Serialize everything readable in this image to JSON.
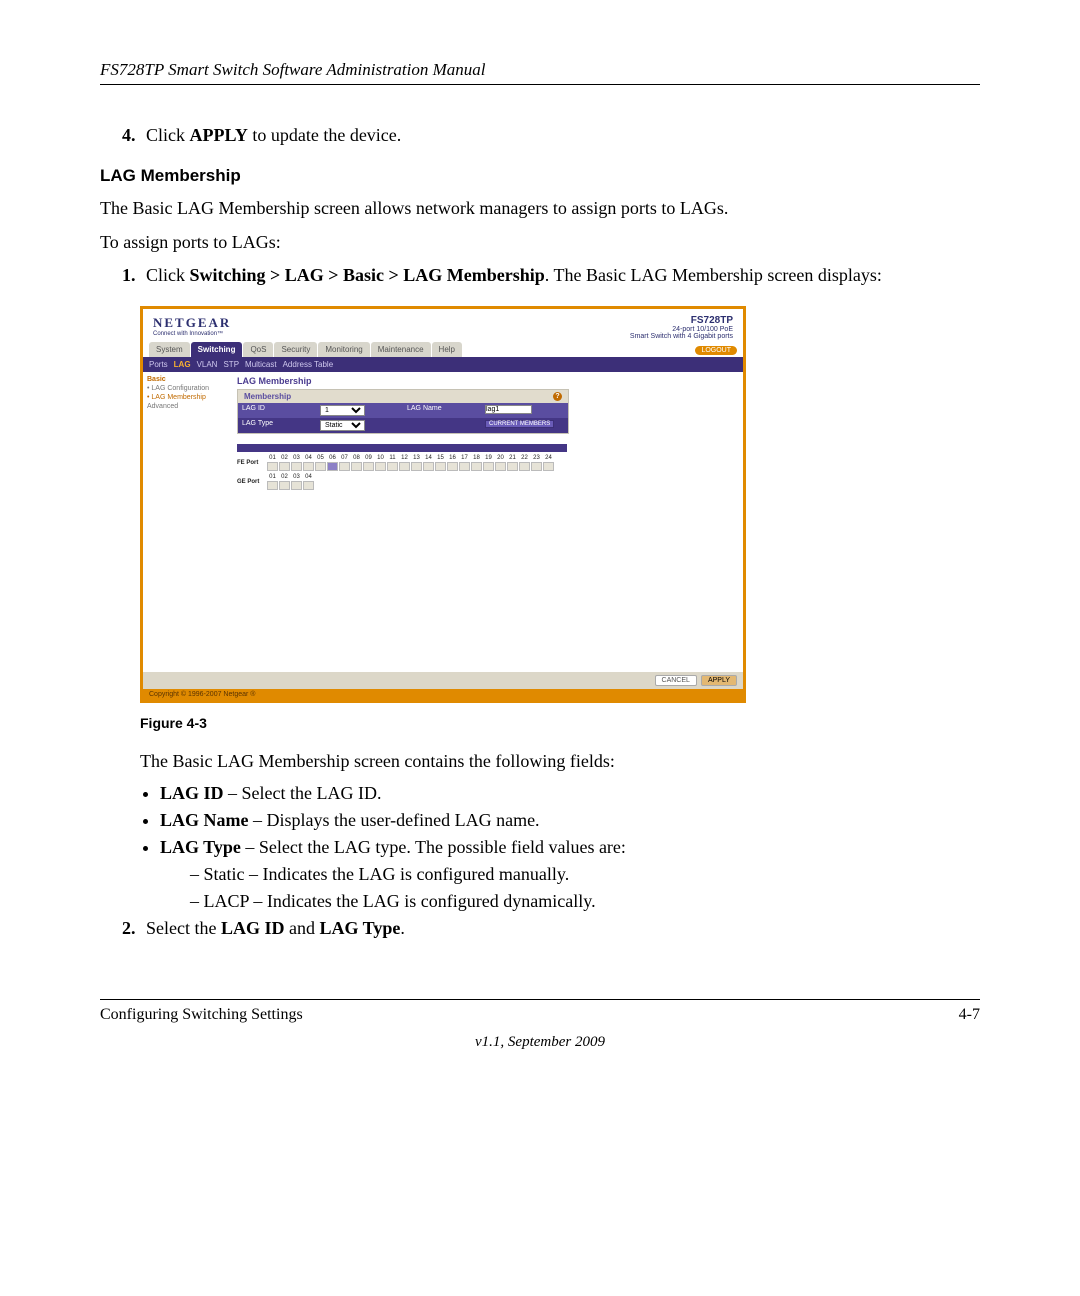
{
  "headerTitle": "FS728TP Smart Switch Software Administration Manual",
  "step4_pre": "Click ",
  "step4_bold": "APPLY",
  "step4_post": " to update the device.",
  "sectionHeading": "LAG Membership",
  "intro1": "The Basic LAG Membership screen allows network managers to assign ports to LAGs.",
  "intro2": "To assign ports to LAGs:",
  "step1_pre": "Click ",
  "step1_bold": "Switching > LAG > Basic > LAG Membership",
  "step1_post": ". The Basic LAG Membership screen displays:",
  "figureCaption": "Figure 4-3",
  "afterFigure": "The Basic LAG Membership screen contains the following fields:",
  "bullet1_bold": "LAG ID",
  "bullet1_rest": " – Select the LAG ID.",
  "bullet2_bold": "LAG Name",
  "bullet2_rest": " – Displays the user-defined LAG name.",
  "bullet3_bold": "LAG Type",
  "bullet3_rest": " – Select the LAG type. The possible field values are:",
  "dash1": "Static – Indicates the LAG is configured manually.",
  "dash2": "LACP – Indicates the LAG is configured dynamically.",
  "step2_pre": "Select the ",
  "step2_bold1": "LAG ID",
  "step2_mid": " and ",
  "step2_bold2": "LAG Type",
  "step2_post": ".",
  "footerLeft": "Configuring Switching Settings",
  "footerRight": "4-7",
  "footerCenter": "v1.1, September 2009",
  "screenshot": {
    "brand": "NETGEAR",
    "brandTag": "Connect with Innovation™",
    "productName": "FS728TP",
    "productDesc1": "24-port 10/100 PoE",
    "productDesc2": "Smart Switch with 4 Gigabit ports",
    "logout": "LOGOUT",
    "tabs": [
      "System",
      "Switching",
      "QoS",
      "Security",
      "Monitoring",
      "Maintenance",
      "Help"
    ],
    "activeTab": "Switching",
    "subtabs": [
      "Ports",
      "LAG",
      "VLAN",
      "STP",
      "Multicast",
      "Address Table"
    ],
    "activeSubtab": "LAG",
    "sidebar": {
      "group": "Basic",
      "items": [
        "LAG Configuration",
        "LAG Membership"
      ],
      "selectedItem": "LAG Membership",
      "advanced": "Advanced"
    },
    "panelTitle": "LAG Membership",
    "membershipHdr": "Membership",
    "rows": [
      {
        "label": "LAG ID",
        "control": "select",
        "value": "1",
        "label2": "LAG Name",
        "control2": "input",
        "value2": "lag1"
      },
      {
        "label": "LAG Type",
        "control": "select",
        "value": "Static",
        "label2": "",
        "control2": "button",
        "value2": "CURRENT MEMBERS"
      }
    ],
    "fePortLabel": "FE Port",
    "fePorts": [
      "01",
      "02",
      "03",
      "04",
      "05",
      "06",
      "07",
      "08",
      "09",
      "10",
      "11",
      "12",
      "13",
      "14",
      "15",
      "16",
      "17",
      "18",
      "19",
      "20",
      "21",
      "22",
      "23",
      "24"
    ],
    "feSelected": 6,
    "gePortLabel": "GE Port",
    "gePorts": [
      "01",
      "02",
      "03",
      "04"
    ],
    "cancelBtn": "CANCEL",
    "applyBtn": "APPLY",
    "copyright": "Copyright © 1996-2007 Netgear ®"
  }
}
